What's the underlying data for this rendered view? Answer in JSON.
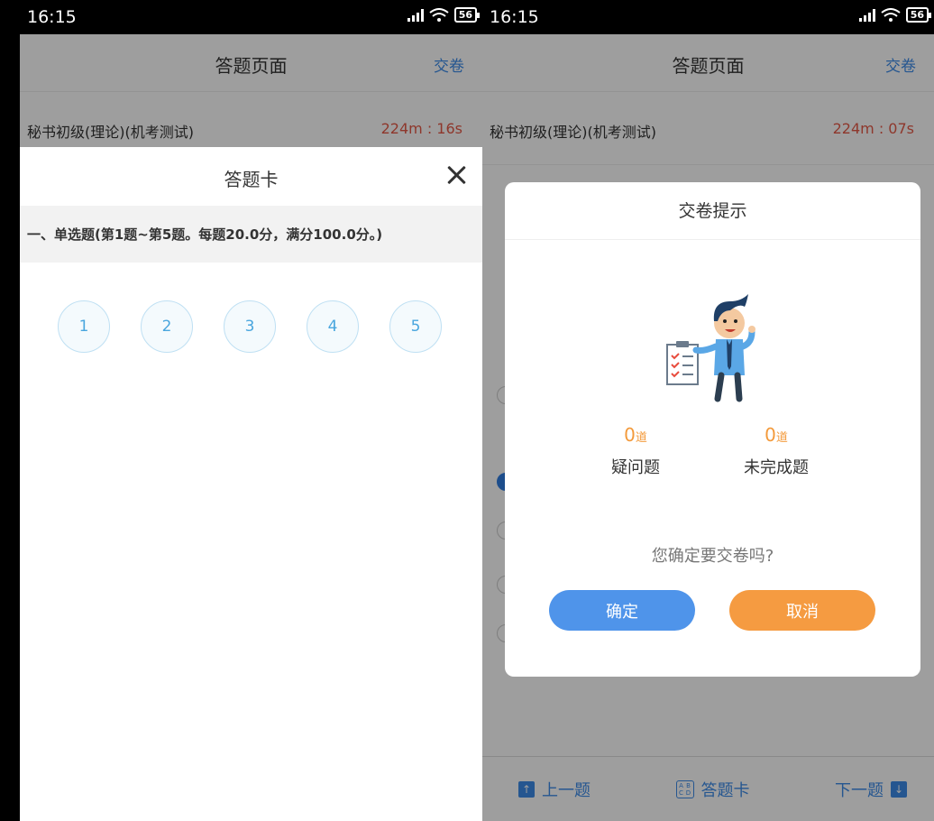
{
  "left": {
    "status": {
      "time": "16:15",
      "battery": "56"
    },
    "nav": {
      "title": "答题页面",
      "submit": "交卷"
    },
    "exam": {
      "name": "秘书初级(理论)(机考测试)",
      "timer": "224m : 16s"
    },
    "sheet": {
      "title": "答题卡",
      "section": "一、单选题(第1题~第5题。每题20.0分，满分100.0分。)",
      "questions": [
        "1",
        "2",
        "3",
        "4",
        "5"
      ]
    }
  },
  "right": {
    "status": {
      "time": "16:15",
      "battery": "56"
    },
    "nav": {
      "title": "答题页面",
      "submit": "交卷"
    },
    "exam": {
      "name": "秘书初级(理论)(机考测试)",
      "timer": "224m : 07s"
    },
    "bottom": {
      "prev": "上一题",
      "card": "答题卡",
      "next": "下一题"
    },
    "modal": {
      "title": "交卷提示",
      "doubt_count": "0",
      "doubt_unit": "道",
      "doubt_label": "疑问题",
      "unfinished_count": "0",
      "unfinished_unit": "道",
      "unfinished_label": "未完成题",
      "confirm_text": "您确定要交卷吗?",
      "ok": "确定",
      "cancel": "取消"
    }
  }
}
